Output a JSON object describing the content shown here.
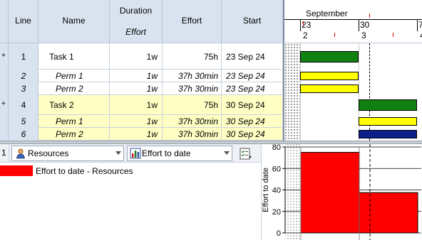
{
  "grid": {
    "headers": {
      "line": "Line",
      "name": "Name",
      "duration": "Duration",
      "duration_sub": "Effort",
      "effort": "Effort",
      "start": "Start"
    },
    "rows": [
      {
        "expander": "+",
        "line": "1",
        "name": "Task 1",
        "duration": "1w",
        "effort": "75h",
        "start": "23 Sep 24",
        "italic": false,
        "highlight": false
      },
      {
        "expander": "",
        "line": "2",
        "name": "Perm 1",
        "duration": "1w",
        "effort": "37h 30min",
        "start": "23 Sep 24",
        "italic": true,
        "highlight": false
      },
      {
        "expander": "",
        "line": "3",
        "name": "Perm 2",
        "duration": "1w",
        "effort": "37h 30min",
        "start": "23 Sep 24",
        "italic": true,
        "highlight": false
      },
      {
        "expander": "+",
        "line": "4",
        "name": "Task 2",
        "duration": "1w",
        "effort": "75h",
        "start": "30 Sep 24",
        "italic": false,
        "highlight": true
      },
      {
        "expander": "",
        "line": "5",
        "name": "Perm 1",
        "duration": "1w",
        "effort": "37h 30min",
        "start": "30 Sep 24",
        "italic": true,
        "highlight": true
      },
      {
        "expander": "",
        "line": "6",
        "name": "Perm 2",
        "duration": "1w",
        "effort": "37h 30min",
        "start": "30 Sep 24",
        "italic": true,
        "highlight": true
      }
    ]
  },
  "gantt": {
    "month_label": "September",
    "week_labels": [
      "23",
      "30",
      "7"
    ],
    "week_numbers": [
      "2",
      "3",
      "4"
    ],
    "bar_colors": [
      "#108010",
      "#ffff00",
      "#ffff00",
      "#108010",
      "#ffff00",
      "#0a1e8c"
    ]
  },
  "toolbar": {
    "line_number": "1",
    "resources_label": "Resources",
    "effort_combo_label": "Effort to date",
    "icons": [
      "person-icon",
      "bar-chart-icon",
      "checklist-icon"
    ]
  },
  "histogram": {
    "legend_label": "Effort to date - Resources",
    "legend_color": "#ff0000"
  },
  "chart_data": {
    "type": "bar",
    "categories": [
      "23 Sep 24",
      "30 Sep 24"
    ],
    "values": [
      75,
      37.5
    ],
    "ylabel": "Effort to date",
    "ylim": [
      0,
      80
    ],
    "y_ticks": [
      "0",
      "20",
      "40",
      "60",
      "80"
    ],
    "bar_color": "#ff0000"
  }
}
